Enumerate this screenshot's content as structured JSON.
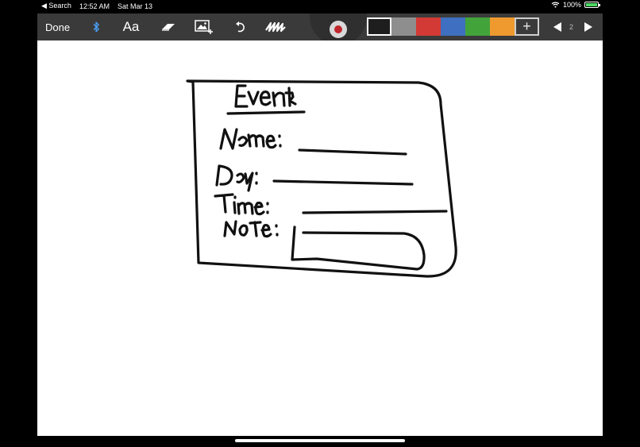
{
  "status_bar": {
    "back_label": "◀ Search",
    "time": "12:52 AM",
    "date": "Sat Mar 13",
    "battery_text": "100%",
    "battery_level": 1.0,
    "wifi_icon": "wifi-icon",
    "battery_icon": "battery-charging-icon"
  },
  "toolbar": {
    "done_label": "Done",
    "text_tool_label": "Aa",
    "page_number": "2",
    "icons": [
      "bluetooth-icon",
      "text-tool",
      "eraser-icon",
      "insert-image-icon",
      "undo-icon",
      "scribble-brush-icon",
      "record-icon",
      "add-color-icon",
      "previous-page-icon",
      "next-page-icon"
    ]
  },
  "colors": {
    "palette": [
      "#1e1e1e",
      "#8e8e8e",
      "#d33a35",
      "#3f6fc0",
      "#43a33b",
      "#ef9a2f"
    ],
    "selected_index": 0,
    "bluetooth": "#4aa3ff",
    "record": "#c0262c"
  },
  "drawing": {
    "content": "handwritten sketch of an event form",
    "handwritten_text": [
      "Event",
      "Name:",
      "Day:",
      "Time:",
      "Note:"
    ]
  }
}
